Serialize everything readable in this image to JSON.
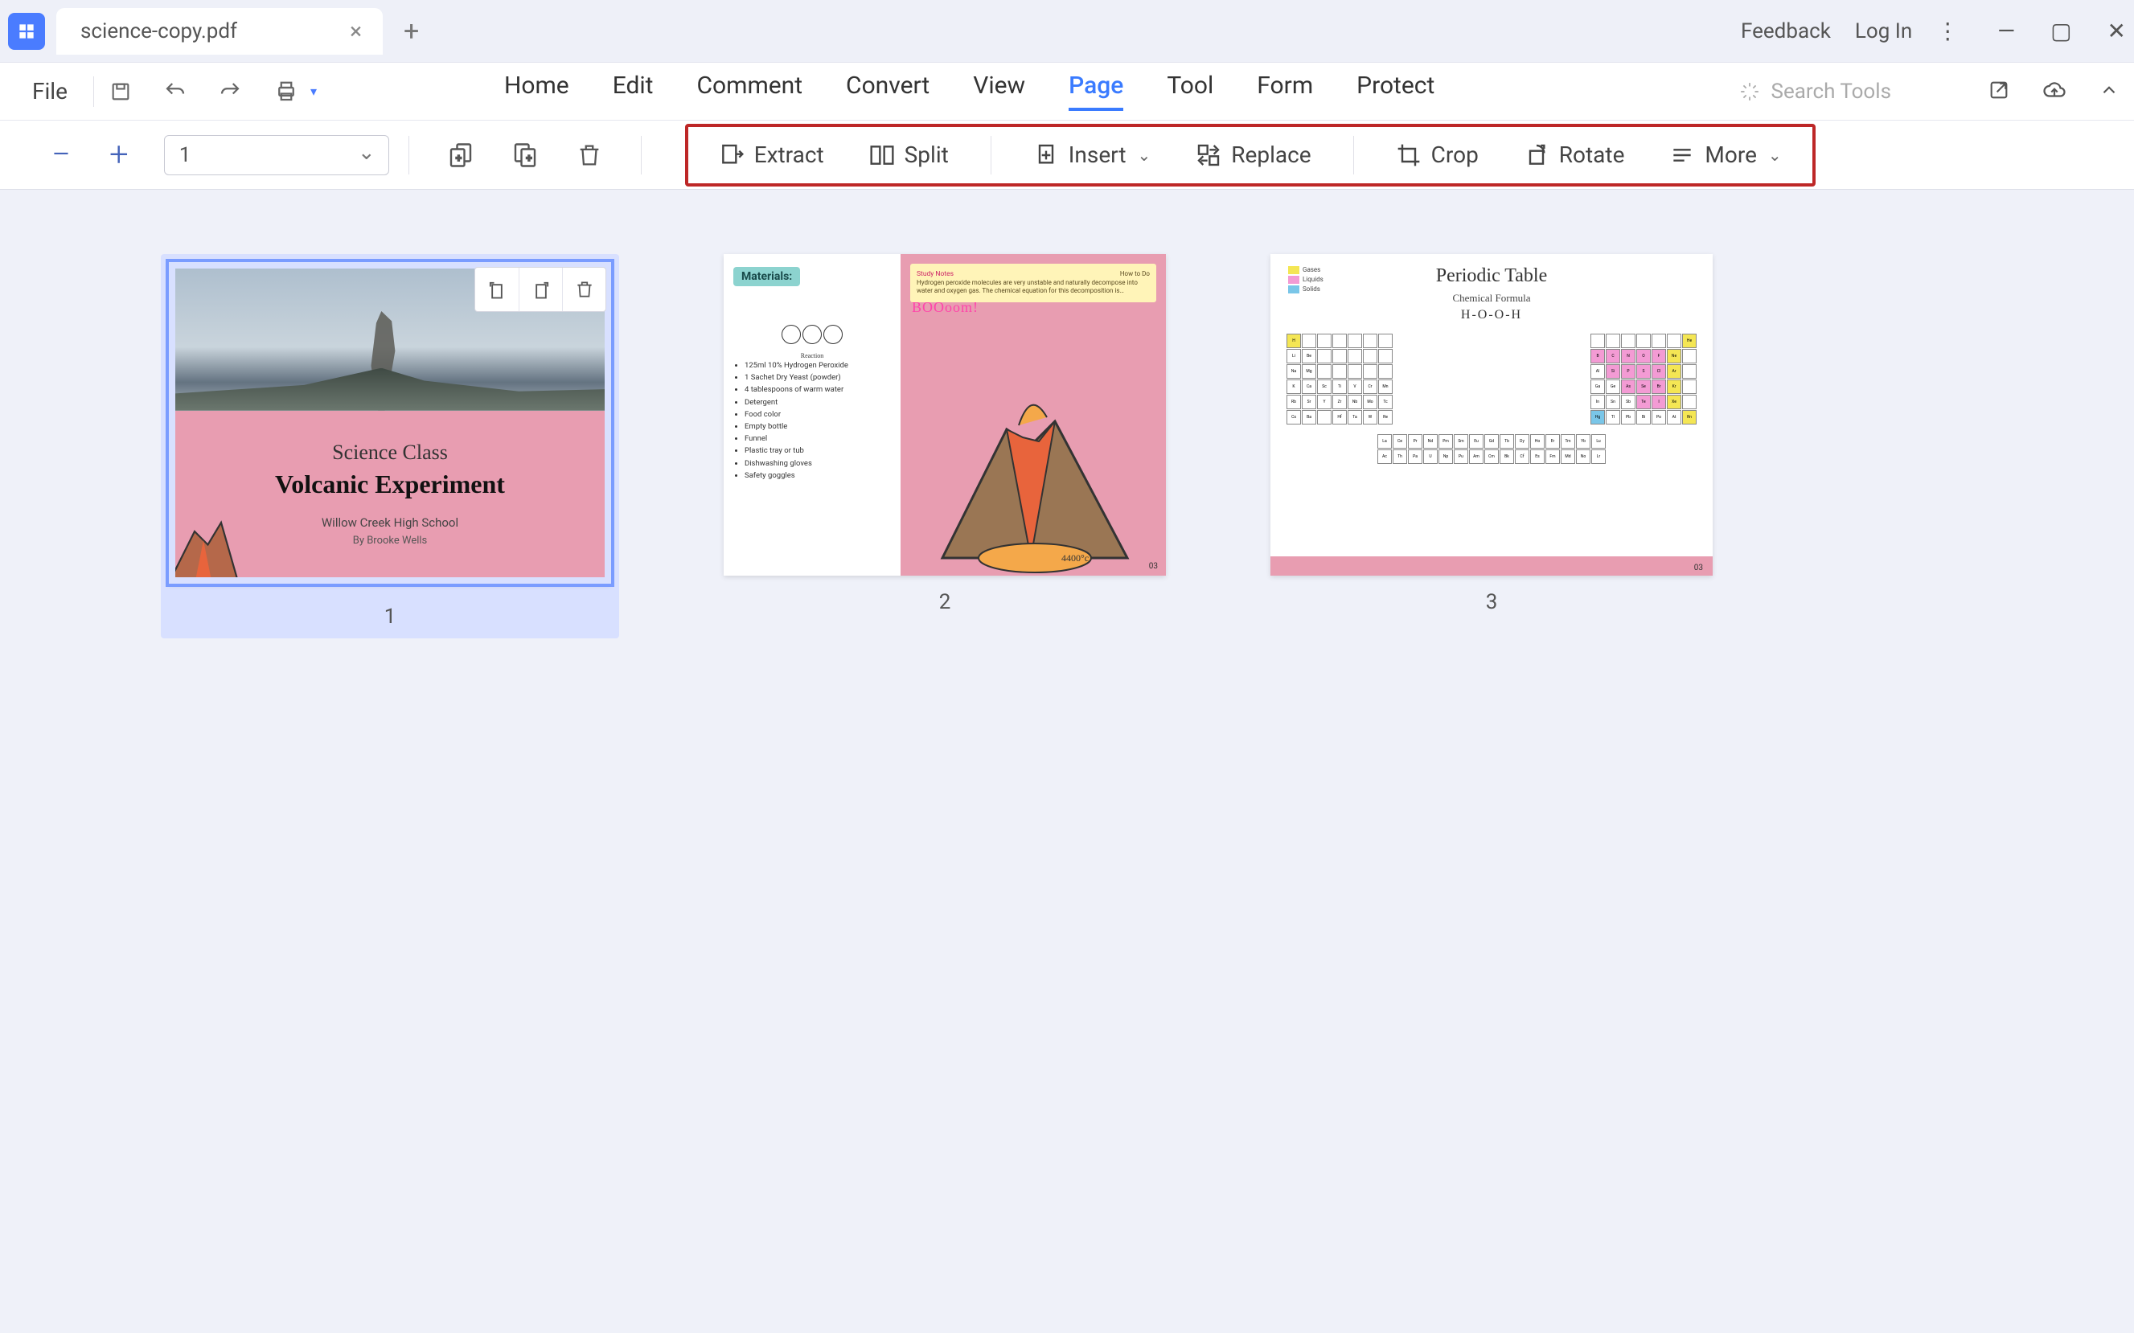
{
  "titlebar": {
    "tab_name": "science-copy.pdf",
    "feedback": "Feedback",
    "login": "Log In"
  },
  "menu": {
    "file": "File",
    "tabs": [
      "Home",
      "Edit",
      "Comment",
      "Convert",
      "View",
      "Page",
      "Tool",
      "Form",
      "Protect"
    ],
    "active_index": 5,
    "search_placeholder": "Search Tools"
  },
  "ribbon": {
    "page_value": "1",
    "extract": "Extract",
    "split": "Split",
    "insert": "Insert",
    "replace": "Replace",
    "crop": "Crop",
    "rotate": "Rotate",
    "more": "More"
  },
  "pages": {
    "count": 3,
    "selected": 1,
    "labels": [
      "1",
      "2",
      "3"
    ],
    "page1": {
      "line1": "Science Class",
      "line2": "Volcanic Experiment",
      "line3": "Willow Creek High School",
      "line4": "By Brooke Wells"
    },
    "page2": {
      "badge": "Materials:",
      "diagram_label": "Reaction",
      "items": [
        "125ml 10% Hydrogen Peroxide",
        "1 Sachet Dry Yeast (powder)",
        "4 tablespoons of warm water",
        "Detergent",
        "Food color",
        "Empty bottle",
        "Funnel",
        "Plastic tray or tub",
        "Dishwashing gloves",
        "Safety goggles"
      ],
      "note_header": "Study Notes",
      "note_side": "How to Do",
      "note_body": "Hydrogen peroxide molecules are very unstable and naturally decompose into water and oxygen gas. The chemical equation for this decomposition is…",
      "boom": "BOOoom!",
      "temp": "4400°c",
      "page_num": "03"
    },
    "page3": {
      "title": "Periodic Table",
      "subtitle": "Chemical Formula",
      "formula": "H-O-O-H",
      "legend": [
        "Gases",
        "Liquids",
        "Solids"
      ],
      "page_num": "03"
    }
  }
}
